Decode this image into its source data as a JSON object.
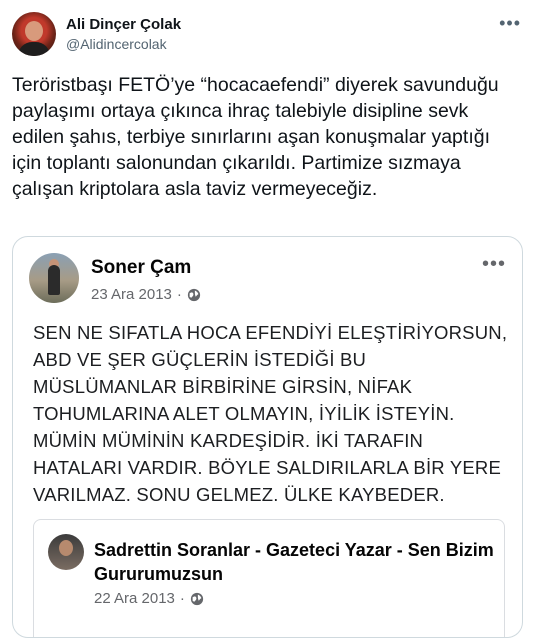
{
  "tweet": {
    "author_name": "Ali Dinçer Çolak",
    "author_handle": "@Alidincercolak",
    "more_label": "•••",
    "text": "Teröristbaşı FETÖ’ye “hocacaefendi” diyerek savunduğu paylaşımı ortaya çıkınca ihraç talebiyle disipline sevk edilen şahıs, terbiye sınırlarını aşan konuşmalar yaptığı için toplantı salonundan çıkarıldı. Partimize sızmaya çalışan kriptolara asla taviz vermeyeceğiz."
  },
  "facebook_post": {
    "author_name": "Soner Çam",
    "date": "23 Ara 2013",
    "separator": "·",
    "more_label": "•••",
    "privacy_icon": "globe-icon",
    "body": "SEN NE SIFATLA HOCA EFENDİYİ ELEŞTİRİYORSUN,\nABD VE ŞER GÜÇLERİN İSTEDİĞİ BU\nMÜSLÜMANLAR BİRBİRİNE GİRSİN, NİFAK\nTOHUMLARINA ALET OLMAYIN, İYİLİK İSTEYİN.\nMÜMİN MÜMİNİN KARDEŞİDİR. İKİ TARAFIN\nHATALARI VARDIR. BÖYLE SALDIRILARLA BİR YERE\nVARILMAZ. SONU GELMEZ. ÜLKE KAYBEDER.",
    "shared_post": {
      "author_name": "Sadrettin Soranlar - Gazeteci  Yazar - Sen Bizim Gururumuzsun",
      "date": "22 Ara 2013",
      "separator": "·",
      "privacy_icon": "globe-icon"
    }
  }
}
